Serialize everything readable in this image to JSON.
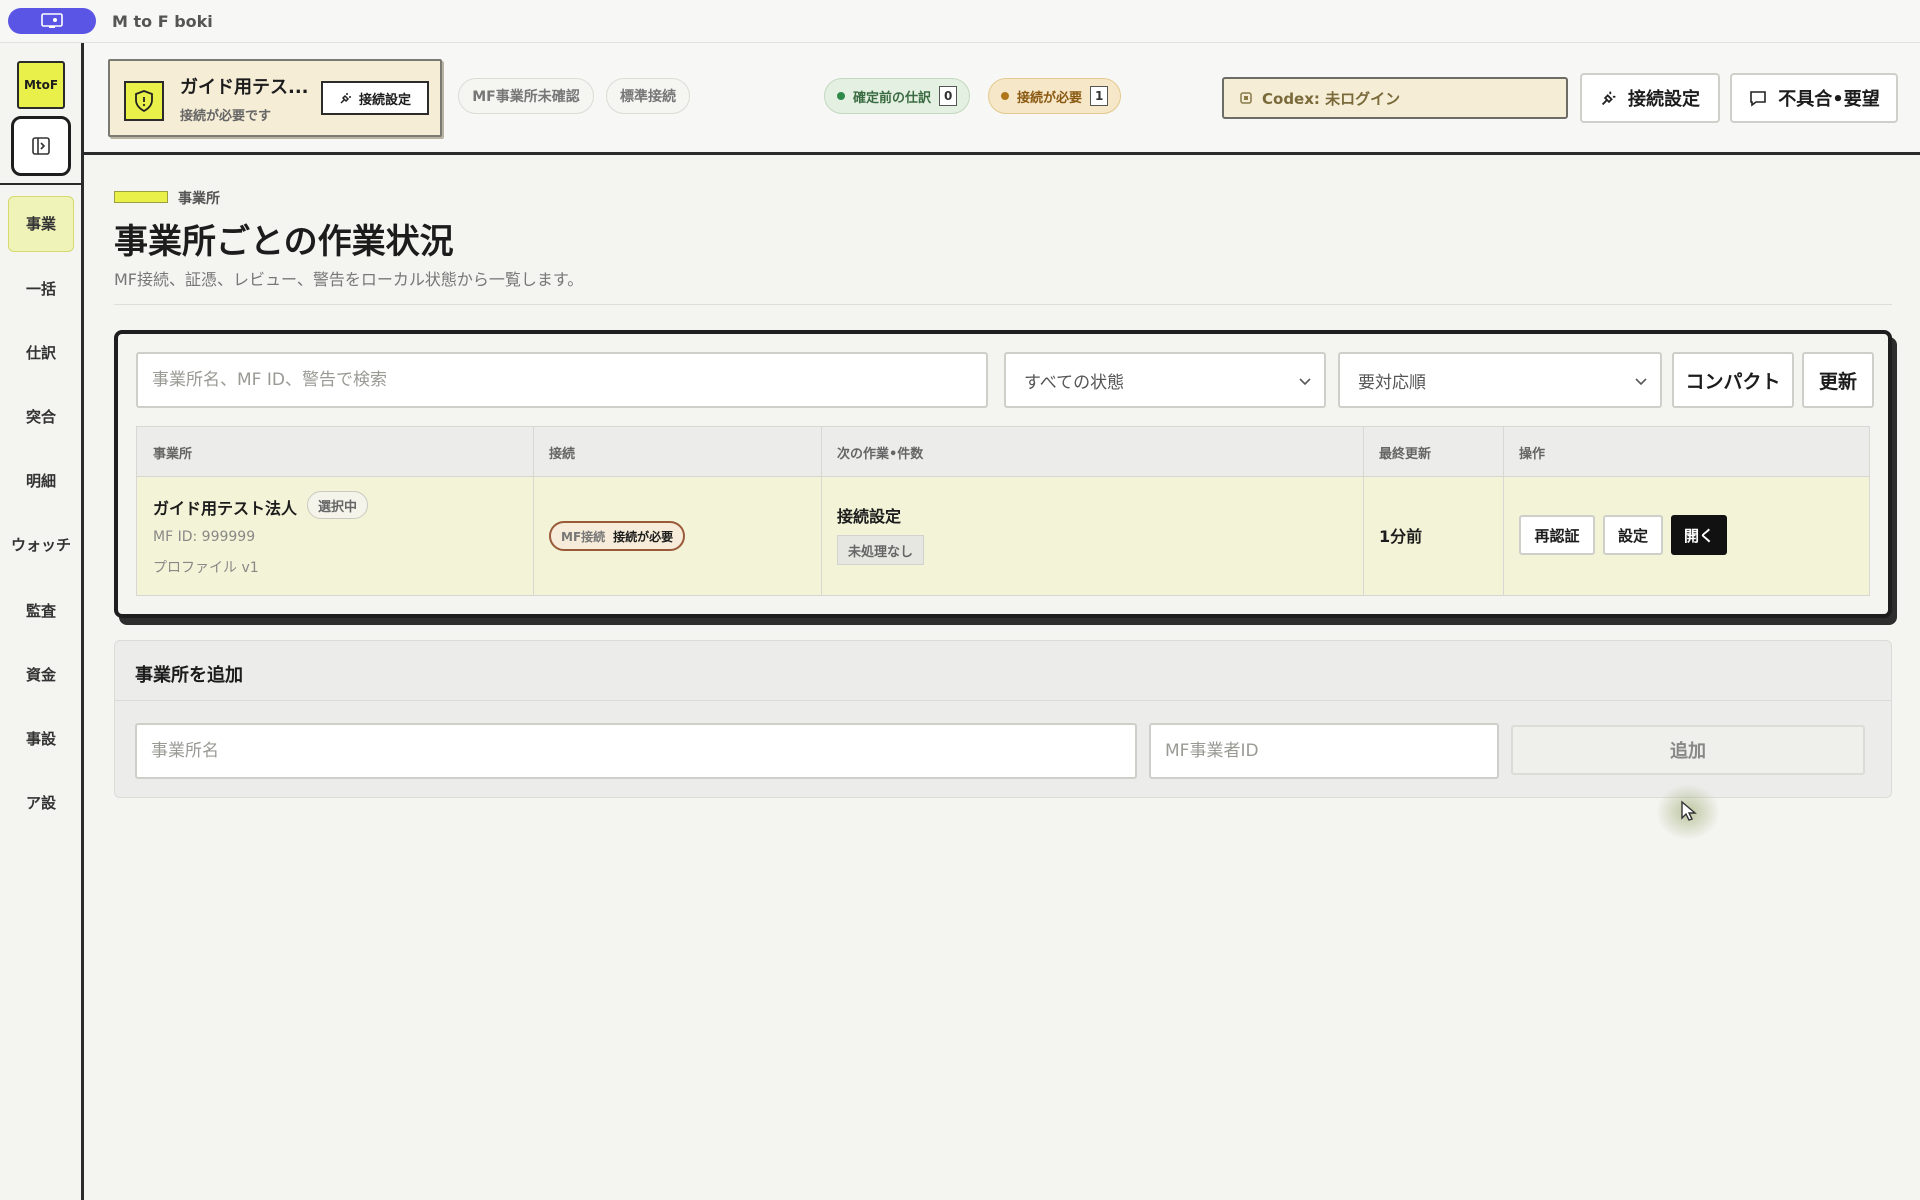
{
  "app": {
    "title": "M to F boki",
    "logo": "MtoF"
  },
  "rail": {
    "items": [
      {
        "label": "事業",
        "active": true
      },
      {
        "label": "一括"
      },
      {
        "label": "仕訳"
      },
      {
        "label": "突合"
      },
      {
        "label": "明細"
      },
      {
        "label": "ウォッチ"
      },
      {
        "label": "監査"
      },
      {
        "label": "資金"
      },
      {
        "label": "事設"
      },
      {
        "label": "ア設"
      }
    ]
  },
  "header": {
    "office_name": "ガイド用テス...",
    "office_status": "接続が必要です",
    "office_connect_label": "接続設定",
    "chip_mf_unconfirmed": "MF事業所未確認",
    "chip_standard": "標準接続",
    "status_pending": {
      "label": "確定前の仕訳",
      "count": "0",
      "color": "#2f8a4a"
    },
    "status_connect": {
      "label": "接続が必要",
      "count": "1",
      "color": "#b0761a"
    },
    "codex": "Codex: 未ログイン",
    "connect_settings": "接続設定",
    "feedback": "不具合•要望"
  },
  "main": {
    "crumb": "事業所",
    "title": "事業所ごとの作業状況",
    "description": "MF接続、証憑、レビュー、警告をローカル状態から一覧します。",
    "filters": {
      "search_placeholder": "事業所名、MF ID、警告で検索",
      "status_select": "すべての状態",
      "sort_select": "要対応順",
      "compact": "コンパクト",
      "refresh": "更新"
    },
    "table": {
      "headers": [
        "事業所",
        "接続",
        "次の作業•件数",
        "最終更新",
        "操作"
      ],
      "rows": [
        {
          "name": "ガイド用テスト法人",
          "selected_badge": "選択中",
          "mf_id": "MF ID: 999999",
          "profile": "プロファイル v1",
          "connection_key": "MF接続",
          "connection_value": "接続が必要",
          "next_task": "接続設定",
          "next_badge": "未処理なし",
          "updated": "1分前",
          "actions": {
            "reauth": "再認証",
            "settings": "設定",
            "open": "開く"
          }
        }
      ]
    },
    "add": {
      "title": "事業所を追加",
      "name_placeholder": "事業所名",
      "mfid_placeholder": "MF事業者ID",
      "button": "追加"
    }
  },
  "colors": {
    "accent_yellow": "#eaf04a",
    "title_pill": "#5b55e6",
    "row_highlight": "#f3f4d7"
  }
}
